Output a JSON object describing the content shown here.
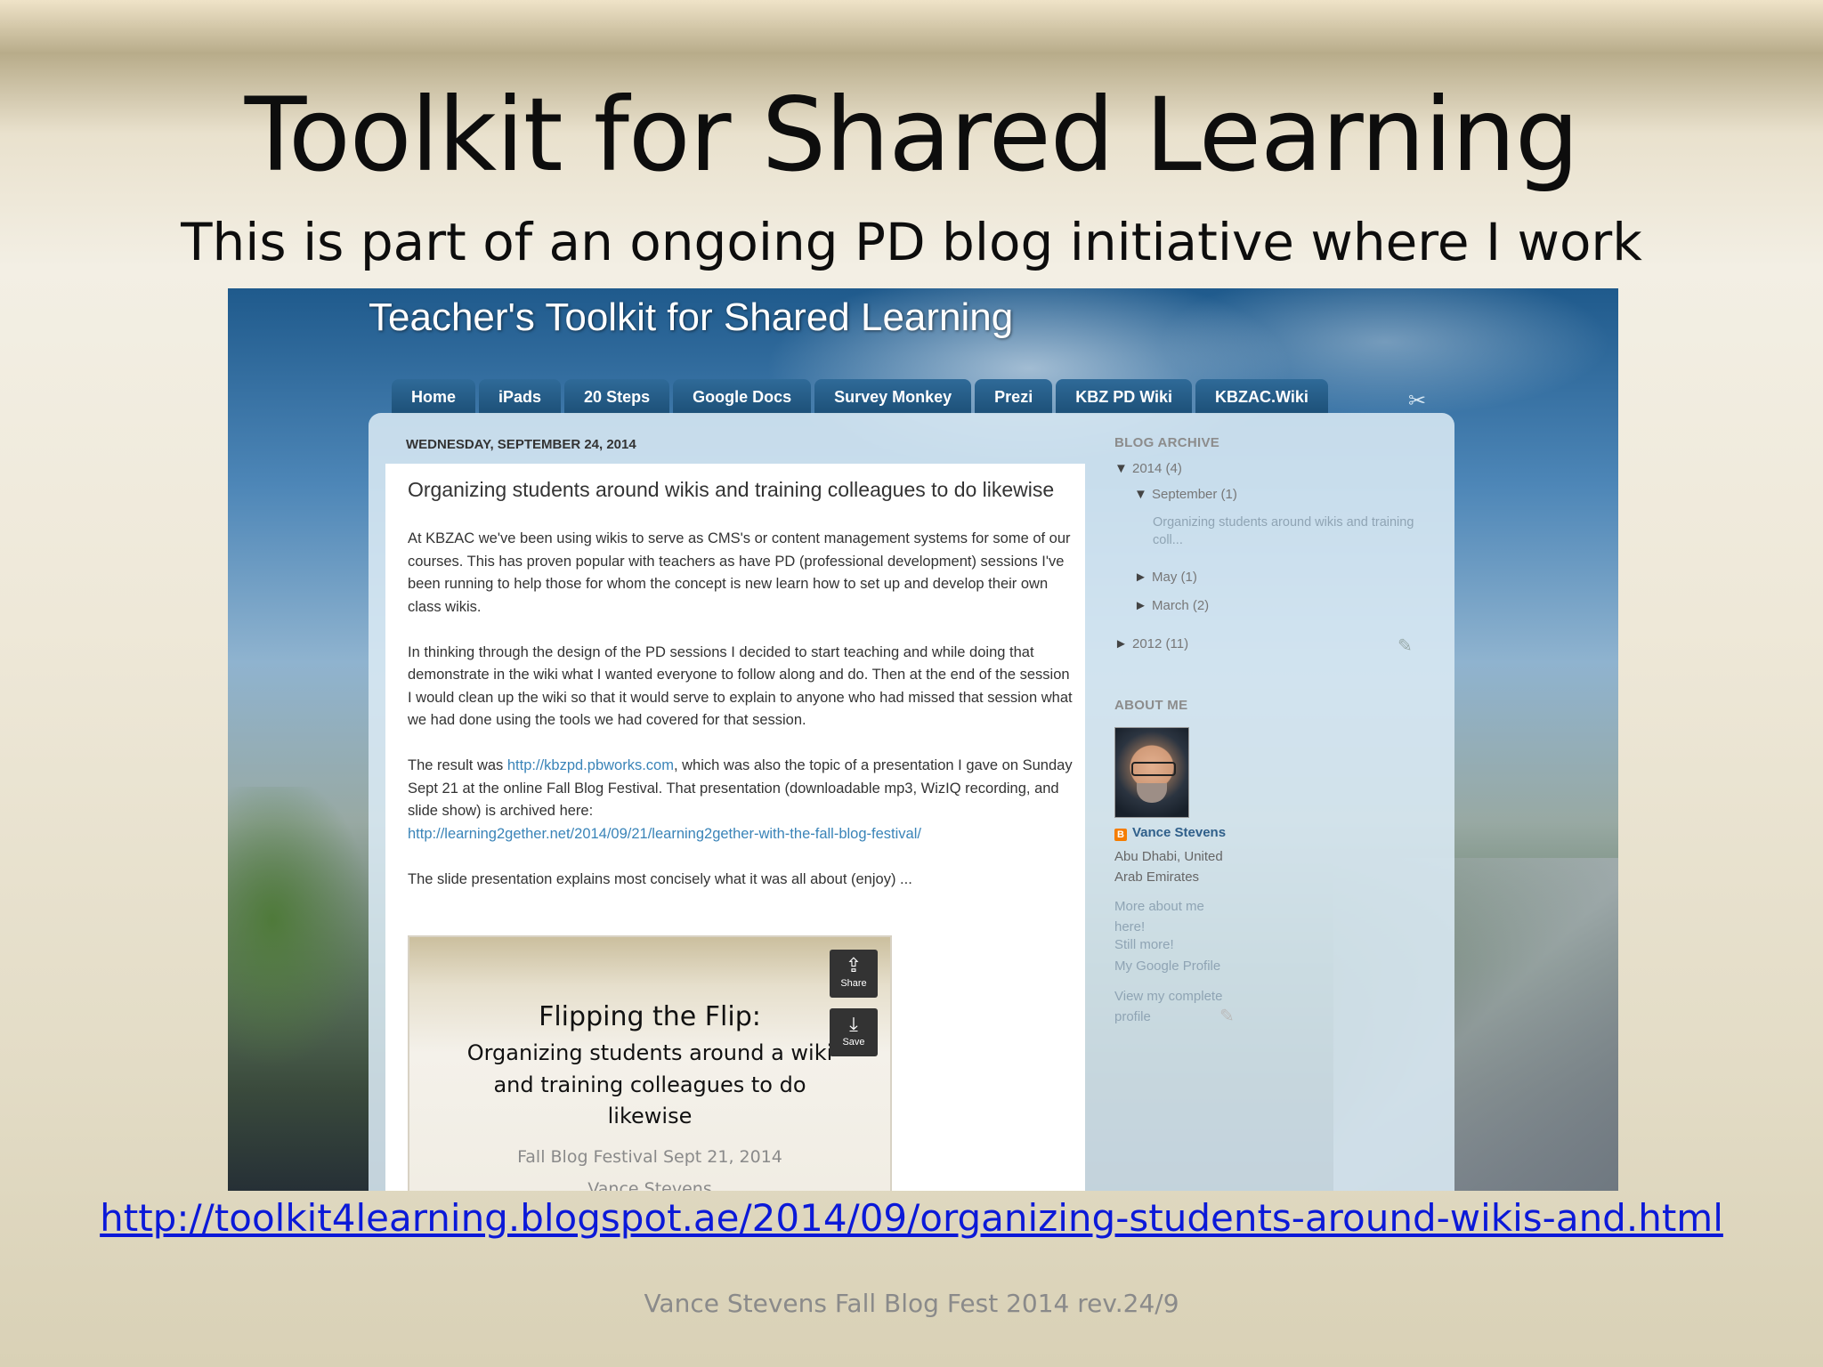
{
  "slide": {
    "title": "Toolkit for Shared Learning",
    "subtitle": "This is part of an ongoing PD blog initiative where I work",
    "url": "http://toolkit4learning.blogspot.ae/2014/09/organizing-students-around-wikis-and.html",
    "footer": "Vance Stevens Fall Blog Fest 2014 rev.24/9"
  },
  "blog": {
    "title": "Teacher's Toolkit for Shared Learning",
    "tabs": [
      "Home",
      "iPads",
      "20 Steps",
      "Google Docs",
      "Survey Monkey",
      "Prezi",
      "KBZ PD Wiki",
      "KBZAC.Wiki"
    ],
    "date_header": "WEDNESDAY, SEPTEMBER 24, 2014",
    "post": {
      "title": "Organizing students around wikis and training colleagues to do likewise",
      "p1": "At KBZAC we've been using wikis to serve as CMS's or content management systems for some of our courses. This has proven popular with teachers as have PD (professional development) sessions I've been running to help those for whom the concept is new learn how to set up and develop their own class wikis.",
      "p2": "In thinking through the design of the PD sessions I decided to start teaching and while doing that demonstrate in the wiki what I wanted everyone to follow along and do. Then at the end of the session I would clean up the wiki so that it would serve to explain to anyone who had missed that session what we had done using the tools we had covered for that session.",
      "p3_a": "The result was ",
      "p3_link": "http://kbzpd.pbworks.com",
      "p3_b": ", which was also the topic of a presentation I gave on Sunday Sept 21 at the online Fall Blog Festival. That presentation (downloadable mp3, WizIQ recording, and slide show) is archived here:",
      "p3_link2": "http://learning2gether.net/2014/09/21/learning2gether-with-the-fall-blog-festival/",
      "p4": "The slide presentation explains most concisely what it was all about (enjoy) ..."
    },
    "embed": {
      "title": "Flipping the Flip:",
      "line1": "Organizing students around a wiki",
      "line2": "and training colleagues to do",
      "line3": "likewise",
      "event": "Fall Blog Festival Sept 21, 2014",
      "author": "Vance Stevens",
      "share_label": "Share",
      "save_label": "Save"
    },
    "sidebar": {
      "archive_heading": "BLOG ARCHIVE",
      "y2014": "2014 (4)",
      "sep": "September (1)",
      "sep_post": "Organizing students around wikis and training coll...",
      "may": "May (1)",
      "march": "March (2)",
      "y2012": "2012 (11)",
      "about_heading": "ABOUT ME",
      "name": "Vance Stevens",
      "location": "Abu Dhabi, United Arab Emirates",
      "more": "More about me here!",
      "still_more": "Still more!",
      "google_profile": "My Google Profile",
      "complete_profile": "View my complete profile"
    }
  }
}
